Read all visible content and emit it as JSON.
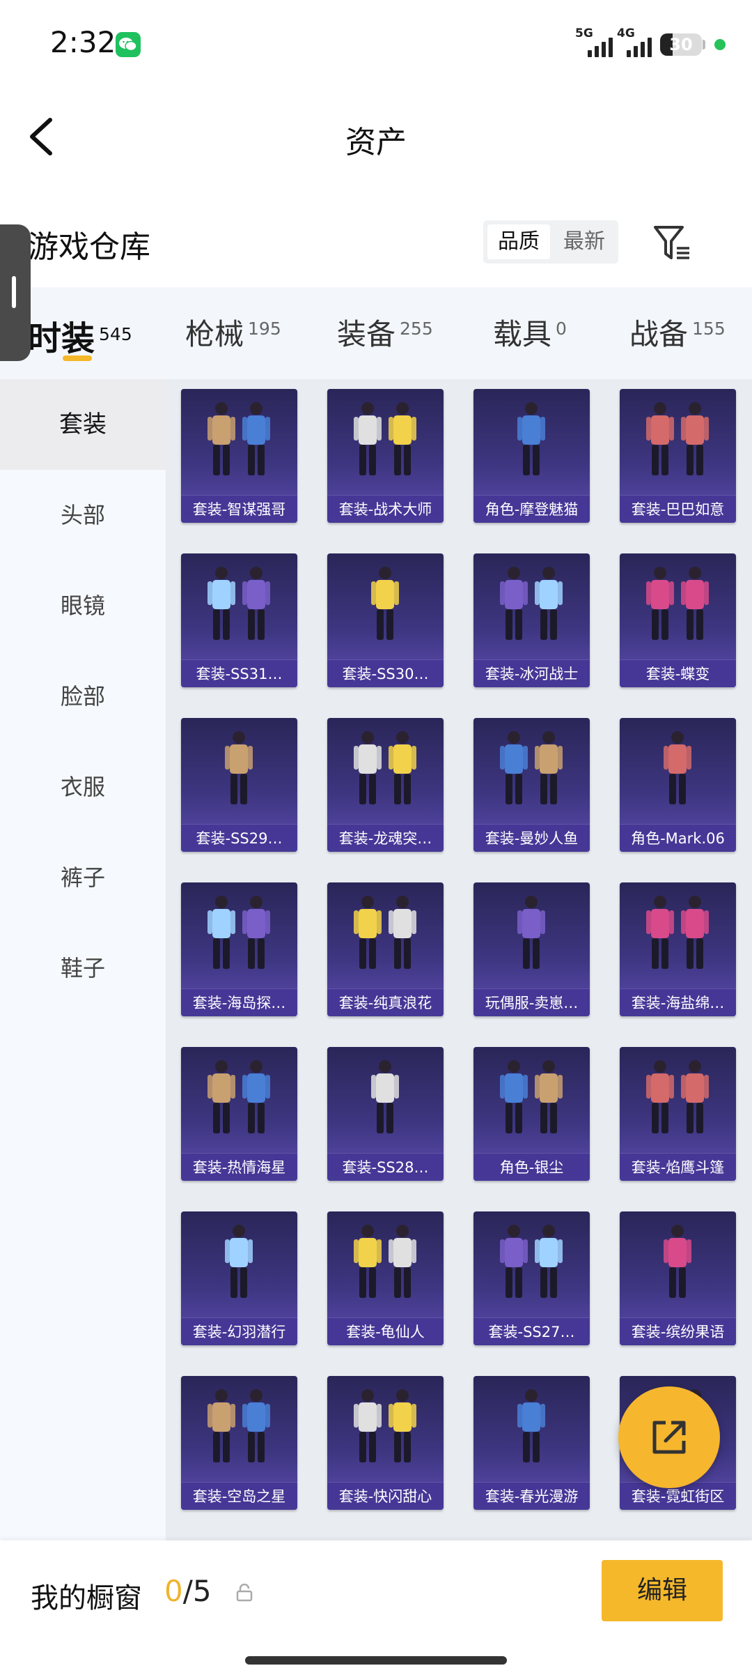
{
  "status_bar": {
    "time": "2:32",
    "network_1": "5G",
    "network_2": "4G",
    "battery": "30",
    "battery_level": 0.3
  },
  "header": {
    "title": "资产"
  },
  "section": {
    "title": "游戏仓库",
    "sort_options": [
      "品质",
      "最新"
    ],
    "sort_selected": "品质"
  },
  "tabs": [
    {
      "label": "时装",
      "count": "545"
    },
    {
      "label": "枪械",
      "count": "195"
    },
    {
      "label": "装备",
      "count": "255"
    },
    {
      "label": "载具",
      "count": "0"
    },
    {
      "label": "战备",
      "count": "155"
    }
  ],
  "categories": [
    "套装",
    "头部",
    "眼镜",
    "脸部",
    "衣服",
    "裤子",
    "鞋子"
  ],
  "items": [
    "套装-智谋强哥",
    "套装-战术大师",
    "角色-摩登魅猫",
    "套装-巴巴如意",
    "套装-SS31…",
    "套装-SS30…",
    "套装-冰河战士",
    "套装-蝶变",
    "套装-SS29…",
    "套装-龙魂突…",
    "套装-曼妙人鱼",
    "角色-Mark.06",
    "套装-海岛探…",
    "套装-纯真浪花",
    "玩偶服-卖崽…",
    "套装-海盐绵…",
    "套装-热情海星",
    "套装-SS28…",
    "角色-银尘",
    "套装-焰鹰斗篷",
    "套装-幻羽潜行",
    "套装-龟仙人",
    "套装-SS27…",
    "套装-缤纷果语",
    "套装-空岛之星",
    "套装-快闪甜心",
    "套装-春光漫游",
    "套装-霓虹街区"
  ],
  "bottom": {
    "showcase_label": "我的橱窗",
    "showcase_current": "0",
    "showcase_total": "/5",
    "edit_label": "编辑"
  },
  "colors": {
    "accent": "#f5b82b",
    "card_bg": "#3d357f",
    "tab_bg": "#f3f7fc"
  }
}
